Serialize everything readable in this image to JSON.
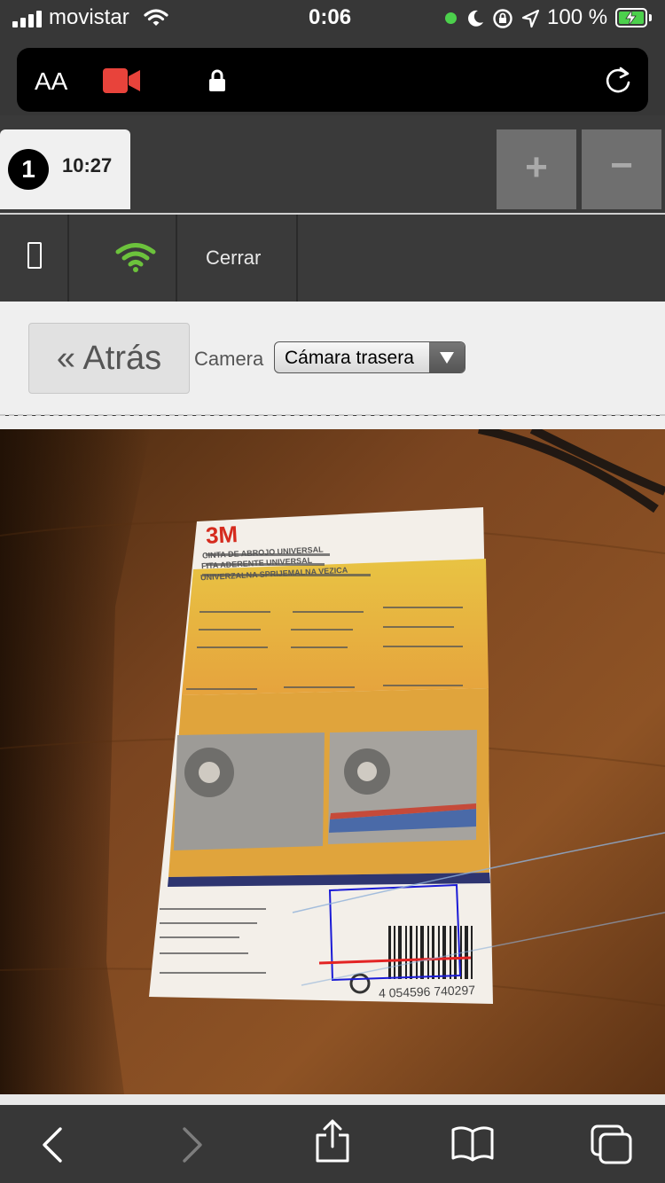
{
  "status_bar": {
    "carrier": "movistar",
    "time": "0:06",
    "battery": "100 %",
    "icons": [
      "signal-icon",
      "wifi-icon",
      "green-dot-icon",
      "moon-icon",
      "orientation-lock-icon",
      "location-icon",
      "battery-charging-icon"
    ]
  },
  "address_bar": {
    "text_size": "AA",
    "icons": [
      "text-size-icon",
      "camera-recording-icon",
      "lock-icon",
      "reload-icon"
    ]
  },
  "tabs": {
    "session_number": "1",
    "session_time": "10:27",
    "zoom_in": "+",
    "zoom_out": "−"
  },
  "toolbar": {
    "close_label": "Cerrar",
    "icons": [
      "phone-outline-icon",
      "wifi-icon"
    ]
  },
  "page": {
    "back_label": "« Atrás",
    "camera_label": "Camera",
    "camera_select_value": "Cámara trasera"
  },
  "camera_view": {
    "product_brand": "3M",
    "product_lines": [
      "CINTA DE ABROJO UNIVERSAL",
      "FITA ADERENTE UNIVERSAL",
      "UNIVERZALNA SPRIJEMALNA VEZICA"
    ],
    "barcode_number": "4 054596 740297",
    "scan_overlay_color": "#1b1bd6",
    "scan_line_color": "#e32424"
  },
  "bottom_bar": {
    "icons": [
      "back-chevron-icon",
      "forward-chevron-icon",
      "share-icon",
      "bookmarks-icon",
      "tabs-icon"
    ]
  },
  "colors": {
    "bar_bg": "#373737",
    "record_red": "#e8433b",
    "wifi_green": "#6cc23c",
    "content_bg": "#efefef"
  }
}
